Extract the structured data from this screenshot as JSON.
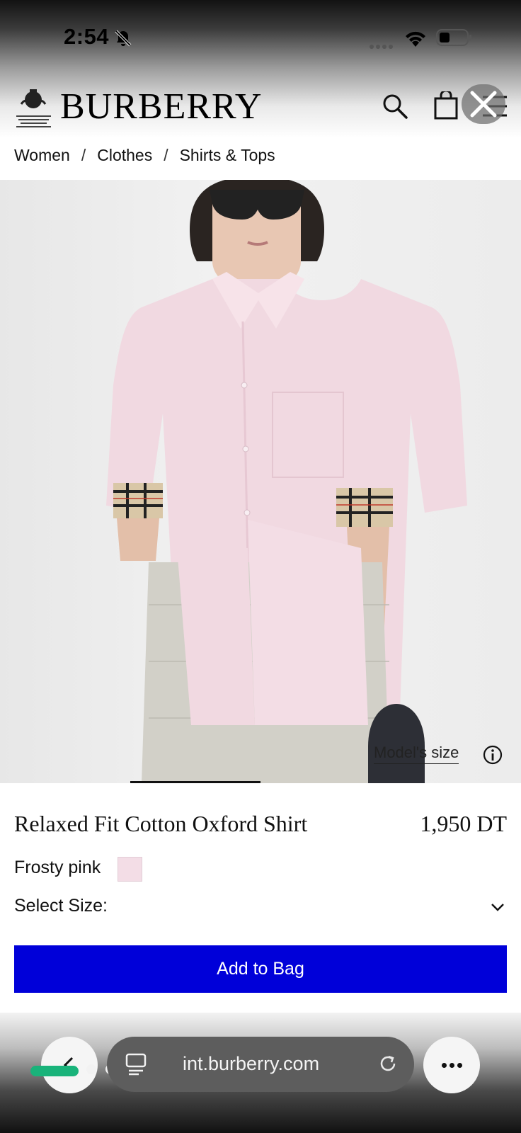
{
  "status": {
    "time": "2:54"
  },
  "header": {
    "brand": "BURBERRY"
  },
  "breadcrumb": [
    "Women",
    "Clothes",
    "Shirts & Tops"
  ],
  "gallery": {
    "model_size_label": "Model's size"
  },
  "product": {
    "title": "Relaxed Fit Cotton Oxford Shirt",
    "price": "1,950 DT",
    "color_name": "Frosty pink",
    "swatch_color": "#f3dde6",
    "size_label": "Select Size:",
    "add_button": "Add to Bag"
  },
  "browser": {
    "url": "int.burberry.com",
    "accent": "#19b37a"
  },
  "colors": {
    "cta": "#0000d9"
  }
}
